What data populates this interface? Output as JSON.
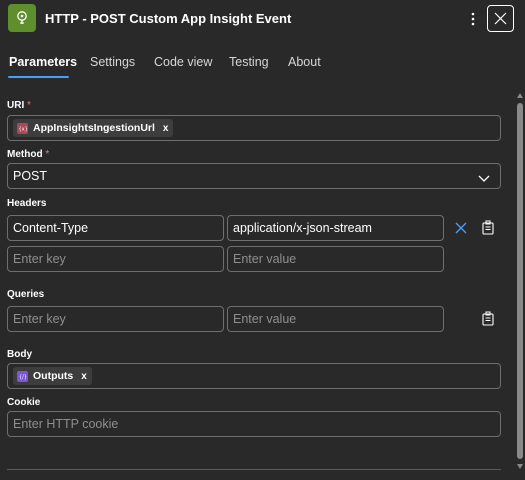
{
  "header": {
    "title": "HTTP - POST Custom App Insight Event",
    "app_icon": "lightbulb-icon",
    "more_icon": "more-vertical-icon",
    "close_icon": "close-icon"
  },
  "tabs": [
    {
      "label": "Parameters",
      "active": true
    },
    {
      "label": "Settings",
      "active": false
    },
    {
      "label": "Code view",
      "active": false
    },
    {
      "label": "Testing",
      "active": false
    },
    {
      "label": "About",
      "active": false
    }
  ],
  "uri": {
    "label": "URI",
    "required_mark": "*",
    "token": {
      "label": "AppInsightsIngestionUrl",
      "remove": "x",
      "color": "#a64a5a"
    }
  },
  "method": {
    "label": "Method",
    "required_mark": "*",
    "value": "POST"
  },
  "headers": {
    "label": "Headers",
    "rows": [
      {
        "key": "Content-Type",
        "value": "application/x-json-stream"
      }
    ],
    "key_placeholder": "Enter key",
    "value_placeholder": "Enter value"
  },
  "queries": {
    "label": "Queries",
    "key_placeholder": "Enter key",
    "value_placeholder": "Enter value"
  },
  "body": {
    "label": "Body",
    "token": {
      "label": "Outputs",
      "remove": "x",
      "color": "#7b56d8"
    }
  },
  "cookie": {
    "label": "Cookie",
    "placeholder": "Enter HTTP cookie"
  },
  "colors": {
    "accent": "#479ef5",
    "background": "#292929",
    "required": "#e37d80"
  }
}
